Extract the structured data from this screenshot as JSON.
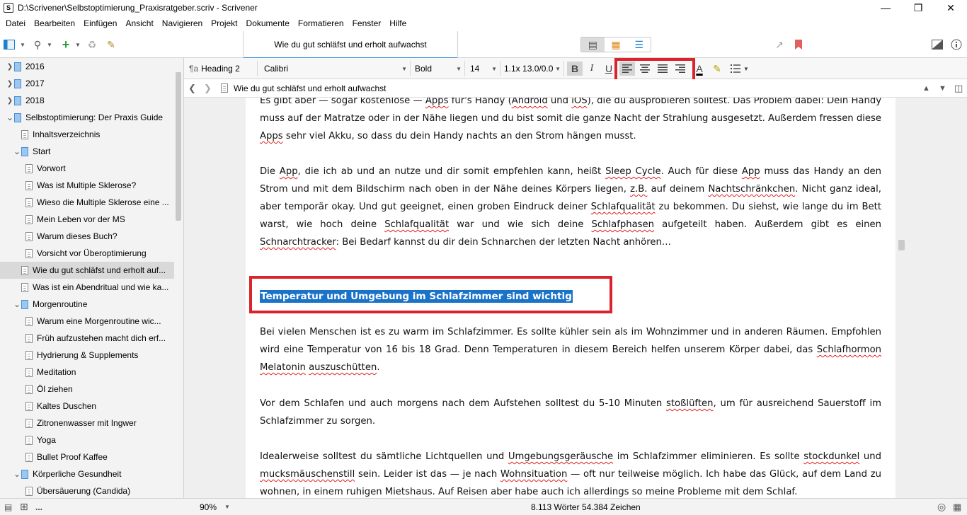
{
  "window": {
    "title": "D:\\Scrivener\\Selbstoptimierung_Praxisratgeber.scriv - Scrivener",
    "app_icon": "S"
  },
  "menu": [
    "Datei",
    "Bearbeiten",
    "Einfügen",
    "Ansicht",
    "Navigieren",
    "Projekt",
    "Dokumente",
    "Formatieren",
    "Fenster",
    "Hilfe"
  ],
  "document_tab": "Wie du gut schläfst und erholt aufwachst",
  "binder": [
    {
      "label": "2016",
      "level": 0,
      "type": "folder",
      "arrow": "right"
    },
    {
      "label": "2017",
      "level": 0,
      "type": "folder",
      "arrow": "right"
    },
    {
      "label": "2018",
      "level": 0,
      "type": "folder",
      "arrow": "right"
    },
    {
      "label": "Selbstoptimierung: Der Praxis Guide",
      "level": 0,
      "type": "folder",
      "arrow": "down"
    },
    {
      "label": "Inhaltsverzeichnis",
      "level": 1,
      "type": "page",
      "arrow": ""
    },
    {
      "label": "Start",
      "level": 1,
      "type": "folder",
      "arrow": "down"
    },
    {
      "label": "Vorwort",
      "level": 2,
      "type": "page",
      "arrow": ""
    },
    {
      "label": "Was ist Multiple Sklerose?",
      "level": 2,
      "type": "page",
      "arrow": ""
    },
    {
      "label": "Wieso die Multiple Sklerose eine ...",
      "level": 2,
      "type": "page",
      "arrow": ""
    },
    {
      "label": "Mein Leben vor der MS",
      "level": 2,
      "type": "page",
      "arrow": ""
    },
    {
      "label": "Warum dieses Buch?",
      "level": 2,
      "type": "page",
      "arrow": ""
    },
    {
      "label": "Vorsicht vor Überoptimierung",
      "level": 2,
      "type": "page",
      "arrow": ""
    },
    {
      "label": "Wie du gut schläfst und erholt auf...",
      "level": 1,
      "type": "page",
      "arrow": "",
      "selected": true
    },
    {
      "label": "Was ist ein Abendritual und wie ka...",
      "level": 1,
      "type": "page",
      "arrow": ""
    },
    {
      "label": "Morgenroutine",
      "level": 1,
      "type": "folder",
      "arrow": "down"
    },
    {
      "label": "Warum eine Morgenroutine wic...",
      "level": 2,
      "type": "page",
      "arrow": ""
    },
    {
      "label": "Früh aufzustehen macht dich erf...",
      "level": 2,
      "type": "page",
      "arrow": ""
    },
    {
      "label": "Hydrierung & Supplements",
      "level": 2,
      "type": "page",
      "arrow": ""
    },
    {
      "label": "Meditation",
      "level": 2,
      "type": "page",
      "arrow": ""
    },
    {
      "label": "Öl ziehen",
      "level": 2,
      "type": "page",
      "arrow": ""
    },
    {
      "label": "Kaltes Duschen",
      "level": 2,
      "type": "page",
      "arrow": ""
    },
    {
      "label": "Zitronenwasser mit Ingwer",
      "level": 2,
      "type": "page",
      "arrow": ""
    },
    {
      "label": "Yoga",
      "level": 2,
      "type": "page",
      "arrow": ""
    },
    {
      "label": "Bullet Proof Kaffee",
      "level": 2,
      "type": "page",
      "arrow": ""
    },
    {
      "label": "Körperliche Gesundheit",
      "level": 1,
      "type": "folder",
      "arrow": "down"
    },
    {
      "label": "Übersäuerung (Candida)",
      "level": 2,
      "type": "page",
      "arrow": ""
    }
  ],
  "format": {
    "style_icon": "¶a",
    "style": "Heading 2",
    "font": "Calibri",
    "weight": "Bold",
    "size": "14",
    "spacing": "1.1x 13.0/0.0",
    "bold": "B",
    "italic": "I",
    "underline": "U",
    "text_color_icon": "A"
  },
  "nav": {
    "title": "Wie du gut schläfst und erholt aufwachst"
  },
  "editor": {
    "p0a": "Es gibt aber — sogar kostenlose — ",
    "p0b": "Apps",
    "p0c": " für's Handy (",
    "p0d": "Android",
    "p0e": " und ",
    "p0f": "iOS",
    "p0g": "), die du ausprobieren solltest. Das Problem dabei: Dein Handy muss auf der Matratze oder in der Nähe liegen und du bist somit die ganze Nacht der Strahlung ausgesetzt. Außerdem fressen diese ",
    "p0h": "Apps",
    "p0i": " sehr viel Akku, so dass du dein Handy nachts an den Strom hängen musst.",
    "p1a": "Die ",
    "p1b": "App",
    "p1c": ", die ich ab und an nutze und dir somit empfehlen kann, heißt ",
    "p1d": "Sleep Cycle",
    "p1e": ". Auch für diese ",
    "p1f": "App",
    "p1g": " muss das Handy an den Strom und mit dem Bildschirm nach oben in der Nähe deines Körpers liegen, ",
    "p1h": "z.B.",
    "p1i": " auf deinem ",
    "p1j": "Nachtschränkchen",
    "p1k": ". Nicht ganz ideal, aber temporär okay. Und gut geeignet, einen groben Eindruck deiner ",
    "p1l": "Schlafqualität",
    "p1m": " zu bekommen. Du siehst, wie lange du im Bett warst, wie hoch deine ",
    "p1n": "Schlafqualität",
    "p1o": " war und wie sich deine ",
    "p1p": "Schlafphasen",
    "p1q": " aufgeteilt haben. Außerdem gibt es einen ",
    "p1r": "Schnarchtracker",
    "p1s": ": Bei Bedarf kannst du dir dein Schnarchen der letzten Nacht anhören…",
    "heading": "Temperatur und Umgebung im Schlafzimmer sind wichtig",
    "p2a": "Bei vielen Menschen ist es zu warm im Schlafzimmer. Es sollte kühler sein als im Wohnzimmer und in anderen Räumen. Empfohlen wird eine Temperatur von 16 bis 18 Grad. Denn Temperaturen in diesem Bereich helfen unserem Körper dabei, das ",
    "p2b": "Schlafhormon",
    "p2c": " ",
    "p2d": "Melatonin",
    "p2e": " ",
    "p2f": "auszuschütten",
    "p2g": ".",
    "p3a": "Vor dem Schlafen und auch morgens nach dem Aufstehen solltest du 5-10 Minuten ",
    "p3b": "stoßlüften",
    "p3c": ", um für ausreichend Sauerstoff im Schlafzimmer zu sorgen.",
    "p4a": "Idealerweise solltest du sämtliche Lichtquellen und ",
    "p4b": "Umgebungsgeräusche",
    "p4c": " im Schlafzimmer eliminieren. Es sollte ",
    "p4d": "stockdunkel",
    "p4e": " und ",
    "p4f": "mucksmäuschenstill",
    "p4g": " sein. Leider ist das — je nach ",
    "p4h": "Wohnsituation",
    "p4i": " — oft nur teilweise möglich. Ich habe das Glück, auf dem Land zu wohnen, in einem ruhigen Mietshaus. Auf Reisen aber habe auch ich allerdings so meine Probleme mit dem Schlaf."
  },
  "status": {
    "zoom": "90%",
    "words": "8.113 Wörter",
    "chars": "54.384 Zeichen",
    "ellipsis": "..."
  },
  "colors": {
    "selection": "#1a73c9",
    "highlight_box": "#d9242c",
    "tab_accent": "#3b8fd9",
    "folder": "#9cc8ee"
  }
}
